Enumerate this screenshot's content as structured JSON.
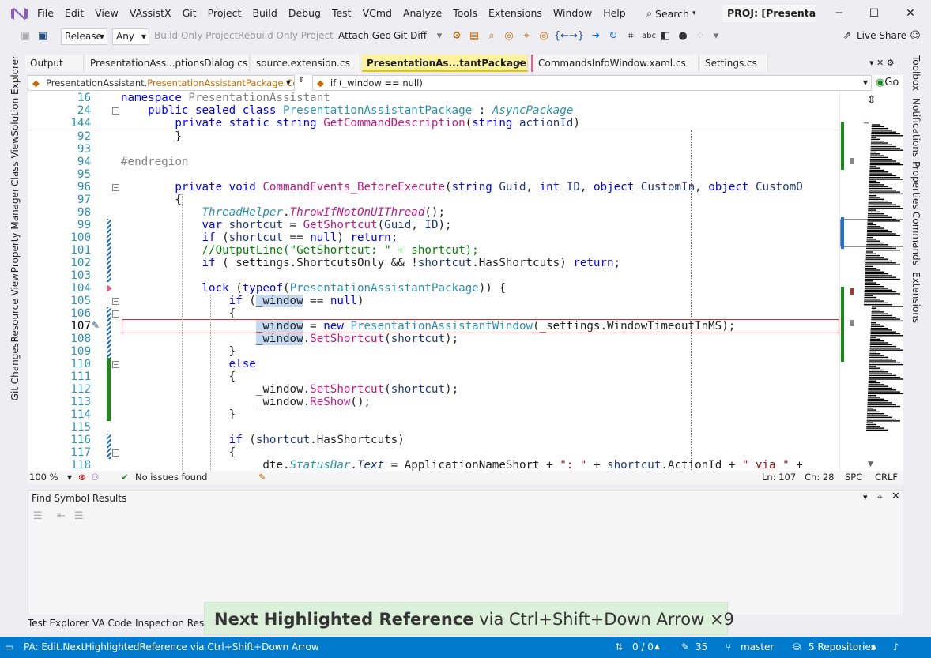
{
  "menu": {
    "items": [
      "File",
      "Edit",
      "View",
      "VAssistX",
      "Git",
      "Project",
      "Build",
      "Debug",
      "Test",
      "VCmd",
      "Analyze",
      "Tools",
      "Extensions",
      "Window",
      "Help"
    ],
    "search_label": "Search",
    "project_title": "PROJ: [Presentation"
  },
  "toolbar": {
    "configuration": "Release",
    "platform": "Any",
    "build_only": "Build Only Project",
    "rebuild_only": "Rebuild Only Project",
    "attach_geo": "Attach Geo",
    "git_diff": "Git Diff",
    "live_share": "Live Share"
  },
  "left_strip": [
    "Solution Explorer",
    "Class View",
    "Property Manager",
    "Resource View",
    "Git Changes"
  ],
  "right_strip": [
    "Toolbox",
    "Notifications",
    "Properties",
    "Commands",
    "Extensions"
  ],
  "tabs": [
    "Output",
    "PresentationAss...ptionsDialog.cs",
    "source.extension.cs",
    "PresentationAs...tantPackage.cs",
    "CommandsInfoWindow.xaml.cs",
    "Settings.cs"
  ],
  "navbar": {
    "scope_prefix": "PresentationAssistant.",
    "scope_member": "PresentationAssistantPackage.Cor",
    "member": "if (_window == null)",
    "go_label": "Go"
  },
  "editor": {
    "zoom": "100 %",
    "issues": "No issues found",
    "ln": "Ln: 107",
    "ch": "Ch: 28",
    "spc": "SPC",
    "crlf": "CRLF"
  },
  "code_lines": [
    {
      "n": "16",
      "segs": [
        [
          "kw",
          "namespace "
        ],
        [
          "gr",
          "PresentationAssistant"
        ]
      ]
    },
    {
      "n": "24",
      "segs": [
        [
          "",
          "    "
        ],
        [
          "kw",
          "public sealed class "
        ],
        [
          "ty",
          "PresentationAssistantPackage"
        ],
        [
          "",
          " : "
        ],
        [
          "ty it",
          "AsyncPackage"
        ]
      ]
    },
    {
      "n": "144",
      "segs": [
        [
          "",
          "        "
        ],
        [
          "kw",
          "private static string "
        ],
        [
          "mtc",
          "GetCommandDescription"
        ],
        [
          "",
          "("
        ],
        [
          "kw",
          "string "
        ],
        [
          "id",
          "actionId"
        ],
        [
          "",
          ")"
        ]
      ]
    },
    {
      "n": "92",
      "segs": [
        [
          "",
          "        }"
        ]
      ]
    },
    {
      "n": "93",
      "segs": [
        [
          "",
          ""
        ]
      ]
    },
    {
      "n": "94",
      "segs": [
        [
          "gr",
          "#endregion"
        ]
      ]
    },
    {
      "n": "95",
      "segs": [
        [
          "",
          ""
        ]
      ]
    },
    {
      "n": "96",
      "segs": [
        [
          "",
          "        "
        ],
        [
          "kw",
          "private void "
        ],
        [
          "mtc",
          "CommandEvents_BeforeExecute"
        ],
        [
          "",
          "("
        ],
        [
          "kw",
          "string "
        ],
        [
          "id",
          "Guid"
        ],
        [
          "",
          ", "
        ],
        [
          "kw",
          "int "
        ],
        [
          "id",
          "ID"
        ],
        [
          "",
          ", "
        ],
        [
          "kw",
          "object "
        ],
        [
          "id",
          "CustomIn"
        ],
        [
          "",
          ", "
        ],
        [
          "kw",
          "object "
        ],
        [
          "id",
          "CustomO"
        ]
      ]
    },
    {
      "n": "97",
      "segs": [
        [
          "",
          "        {"
        ]
      ]
    },
    {
      "n": "98",
      "segs": [
        [
          "",
          "            "
        ],
        [
          "ty it",
          "ThreadHelper"
        ],
        [
          "",
          "."
        ],
        [
          "mtc it",
          "ThrowIfNotOnUIThread"
        ],
        [
          "",
          "();"
        ]
      ]
    },
    {
      "n": "99",
      "segs": [
        [
          "",
          "            "
        ],
        [
          "kw",
          "var "
        ],
        [
          "id",
          "shortcut"
        ],
        [
          "",
          " = "
        ],
        [
          "mtc",
          "GetShortcut"
        ],
        [
          "",
          "("
        ],
        [
          "id",
          "Guid"
        ],
        [
          "",
          ", "
        ],
        [
          "id",
          "ID"
        ],
        [
          "",
          ");"
        ]
      ]
    },
    {
      "n": "100",
      "segs": [
        [
          "",
          "            "
        ],
        [
          "kw",
          "if "
        ],
        [
          "",
          "("
        ],
        [
          "id",
          "shortcut"
        ],
        [
          "",
          " == "
        ],
        [
          "kw",
          "null"
        ],
        [
          "",
          ") "
        ],
        [
          "kw",
          "return"
        ],
        [
          "",
          ";"
        ]
      ]
    },
    {
      "n": "101",
      "segs": [
        [
          "",
          "            "
        ],
        [
          "cm",
          "//OutputLine(\"GetShortcut: \" + shortcut);"
        ]
      ]
    },
    {
      "n": "102",
      "segs": [
        [
          "",
          "            "
        ],
        [
          "kw",
          "if "
        ],
        [
          "",
          "(_settings.ShortcutsOnly && !"
        ],
        [
          "id",
          "shortcut"
        ],
        [
          "",
          ".HasShortcuts) "
        ],
        [
          "kw",
          "return"
        ],
        [
          "",
          ";"
        ]
      ]
    },
    {
      "n": "103",
      "segs": [
        [
          "",
          ""
        ]
      ]
    },
    {
      "n": "104",
      "segs": [
        [
          "",
          "            "
        ],
        [
          "kw",
          "lock "
        ],
        [
          "",
          "("
        ],
        [
          "kw",
          "typeof"
        ],
        [
          "",
          "("
        ],
        [
          "ty",
          "PresentationAssistantPackage"
        ],
        [
          "",
          ")) {"
        ]
      ]
    },
    {
      "n": "105",
      "segs": [
        [
          "",
          "                "
        ],
        [
          "kw",
          "if "
        ],
        [
          "",
          "("
        ],
        [
          "hl",
          "_window"
        ],
        [
          "",
          " == "
        ],
        [
          "kw",
          "null"
        ],
        [
          "",
          ")"
        ]
      ]
    },
    {
      "n": "106",
      "segs": [
        [
          "",
          "                {"
        ]
      ]
    },
    {
      "n": "107",
      "segs": [
        [
          "",
          "                    "
        ],
        [
          "hl",
          "_window"
        ],
        [
          "",
          " = "
        ],
        [
          "kw",
          "new "
        ],
        [
          "ty",
          "PresentationAssistantWindow"
        ],
        [
          "",
          "(_settings.WindowTimeoutInMS);"
        ]
      ]
    },
    {
      "n": "108",
      "segs": [
        [
          "",
          "                    "
        ],
        [
          "hl",
          "_window"
        ],
        [
          "",
          "."
        ],
        [
          "mtc",
          "SetShortcut"
        ],
        [
          "",
          "("
        ],
        [
          "id",
          "shortcut"
        ],
        [
          "",
          ");"
        ]
      ]
    },
    {
      "n": "109",
      "segs": [
        [
          "",
          "                }"
        ]
      ]
    },
    {
      "n": "110",
      "segs": [
        [
          "",
          "                "
        ],
        [
          "kw",
          "else"
        ]
      ]
    },
    {
      "n": "111",
      "segs": [
        [
          "",
          "                {"
        ]
      ]
    },
    {
      "n": "112",
      "segs": [
        [
          "",
          "                    _window."
        ],
        [
          "mtc",
          "SetShortcut"
        ],
        [
          "",
          "("
        ],
        [
          "id",
          "shortcut"
        ],
        [
          "",
          ");"
        ]
      ]
    },
    {
      "n": "113",
      "segs": [
        [
          "",
          "                    _window."
        ],
        [
          "mtc",
          "ReShow"
        ],
        [
          "",
          "();"
        ]
      ]
    },
    {
      "n": "114",
      "segs": [
        [
          "",
          "                }"
        ]
      ]
    },
    {
      "n": "115",
      "segs": [
        [
          "",
          ""
        ]
      ]
    },
    {
      "n": "116",
      "segs": [
        [
          "",
          "                "
        ],
        [
          "kw",
          "if "
        ],
        [
          "",
          "("
        ],
        [
          "id",
          "shortcut"
        ],
        [
          "",
          ".HasShortcuts)"
        ]
      ]
    },
    {
      "n": "117",
      "segs": [
        [
          "",
          "                {"
        ]
      ]
    },
    {
      "n": "118",
      "segs": [
        [
          "",
          "                    _dte."
        ],
        [
          "ty it",
          "StatusBar"
        ],
        [
          "",
          "."
        ],
        [
          "id it",
          "Text"
        ],
        [
          "",
          " = ApplicationNameShort + "
        ],
        [
          "st",
          "\": \""
        ],
        [
          "",
          " + "
        ],
        [
          "id",
          "shortcut"
        ],
        [
          "",
          ".ActionId + "
        ],
        [
          "st",
          "\" via \""
        ],
        [
          "",
          " +"
        ]
      ]
    }
  ],
  "find_symbol": {
    "title": "Find Symbol Results"
  },
  "bottom_tabs": [
    "Test Explorer",
    "VA Code Inspection Results"
  ],
  "toast": {
    "bold": "Next Highlighted Reference",
    "rest": " via Ctrl+Shift+Down Arrow ×9"
  },
  "statusbar": {
    "message": "PA: Edit.NextHighlightedReference via Ctrl+Shift+Down Arrow",
    "sync": "0 / 0",
    "edits": "35",
    "branch": "master",
    "repos": "5 Repositories"
  },
  "colors": {
    "accent": "#007acc",
    "active_tab": "#fff29d",
    "toast_bg": "#dcf1dc",
    "change_saved": "#1a8a1a",
    "change_unsaved": "#1e6fd0"
  }
}
